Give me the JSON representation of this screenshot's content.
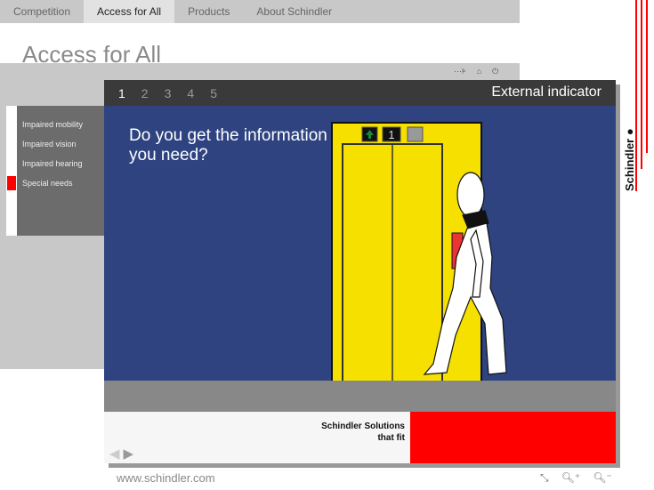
{
  "nav": {
    "tabs": [
      {
        "label": "Competition"
      },
      {
        "label": "Access for All"
      },
      {
        "label": "Products"
      },
      {
        "label": "About Schindler"
      }
    ],
    "active": "Access for All"
  },
  "page_title": "Access for All",
  "sidebar": {
    "items": [
      {
        "label": "Impaired mobility"
      },
      {
        "label": "Impaired vision"
      },
      {
        "label": "Impaired hearing"
      },
      {
        "label": "Special needs"
      }
    ],
    "selected": "Special needs"
  },
  "panel": {
    "steps": [
      "1",
      "2",
      "3",
      "4",
      "5"
    ],
    "active_step": "1",
    "title": "External indicator",
    "question": "Do you get the information you need?",
    "floor_display": "1",
    "slogan_line1": "Schindler Solutions",
    "slogan_line2": "that fit"
  },
  "brand": {
    "logo": "Schindler",
    "accent": "#ff0000",
    "panel_bg": "#2e4380",
    "elevator": "#f5e000"
  },
  "footer": {
    "url": "www.schindler.com"
  },
  "icons": [
    "sitemap-icon",
    "home-icon",
    "power-icon",
    "fullscreen-icon",
    "zoom-in-icon",
    "zoom-out-icon",
    "prev-arrow-icon",
    "next-arrow-icon"
  ]
}
